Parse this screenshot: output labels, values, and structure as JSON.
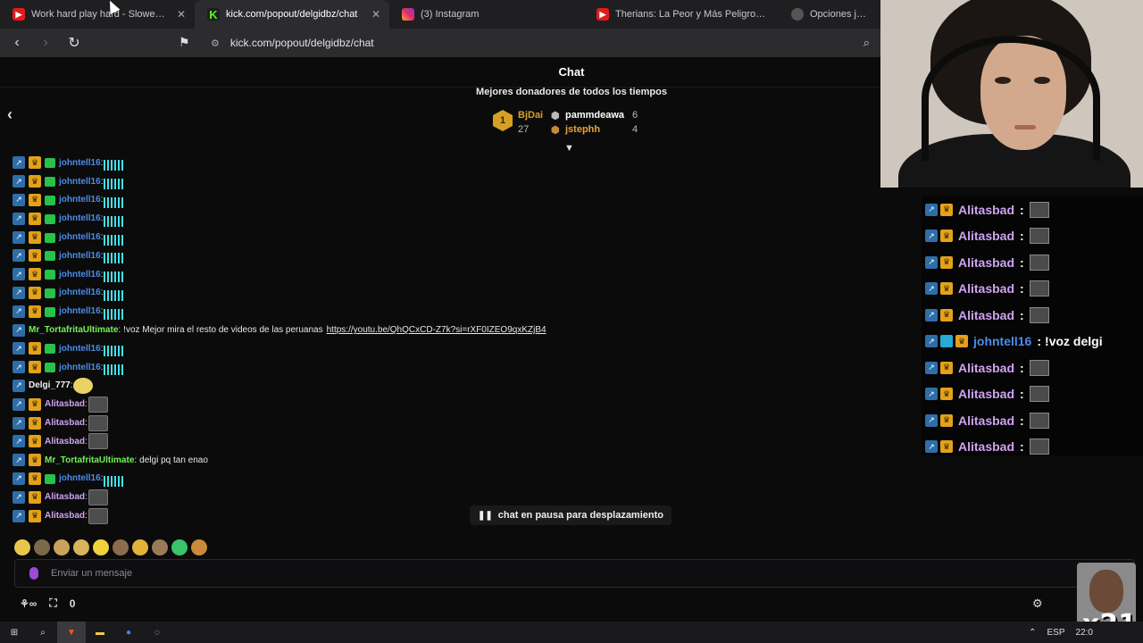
{
  "tabs": [
    {
      "title": "Work hard play hard - Slowed (T",
      "favicon": "youtube-icon"
    },
    {
      "title": "kick.com/popout/delgidbz/chat",
      "favicon": "kick-icon",
      "active": true
    },
    {
      "title": "(3) Instagram",
      "favicon": "instagram-icon"
    },
    {
      "title": "Therians: La Peor y Más Peligrosa Mo",
      "favicon": "youtube-icon"
    },
    {
      "title": "Opciones juegos",
      "favicon": "settings-icon"
    }
  ],
  "address": {
    "url": "kick.com/popout/delgidbz/chat"
  },
  "chat": {
    "title": "Chat",
    "donors_title": "Mejores donadores de todos los tiempos",
    "donors": [
      {
        "rank": "1",
        "name": "BjDai",
        "amount": "27"
      },
      {
        "name": "pammdeawa",
        "amount": "6"
      },
      {
        "name": "jstephh",
        "amount": "4"
      }
    ],
    "messages": [
      {
        "user": "johntell16",
        "color": "blue",
        "badges": [
          "verified",
          "crown",
          "gift"
        ],
        "emote": "bars"
      },
      {
        "user": "johntell16",
        "color": "blue",
        "badges": [
          "verified",
          "crown",
          "gift"
        ],
        "emote": "bars"
      },
      {
        "user": "johntell16",
        "color": "blue",
        "badges": [
          "verified",
          "crown",
          "gift"
        ],
        "emote": "bars"
      },
      {
        "user": "johntell16",
        "color": "blue",
        "badges": [
          "verified",
          "crown",
          "gift"
        ],
        "emote": "bars"
      },
      {
        "user": "johntell16",
        "color": "blue",
        "badges": [
          "verified",
          "crown",
          "gift"
        ],
        "emote": "bars"
      },
      {
        "user": "johntell16",
        "color": "blue",
        "badges": [
          "verified",
          "crown",
          "gift"
        ],
        "emote": "bars"
      },
      {
        "user": "johntell16",
        "color": "blue",
        "badges": [
          "verified",
          "crown",
          "gift"
        ],
        "emote": "bars"
      },
      {
        "user": "johntell16",
        "color": "blue",
        "badges": [
          "verified",
          "crown",
          "gift"
        ],
        "emote": "bars"
      },
      {
        "user": "johntell16",
        "color": "blue",
        "badges": [
          "verified",
          "crown",
          "gift"
        ],
        "emote": "bars"
      },
      {
        "user": "Mr_TortafritaUltimate",
        "color": "green",
        "badges": [
          "verified"
        ],
        "text": "!voz Mejor mira el resto de videos de las peruanas",
        "link": "https://youtu.be/QhQCxCD-Z7k?si=rXF0IZEO9qxKZjB4"
      },
      {
        "user": "johntell16",
        "color": "blue",
        "badges": [
          "verified",
          "crown",
          "gift"
        ],
        "emote": "bars"
      },
      {
        "user": "johntell16",
        "color": "blue",
        "badges": [
          "verified",
          "crown",
          "gift"
        ],
        "emote": "bars"
      },
      {
        "user": "Delgi_777",
        "color": "white",
        "badges": [
          "verified"
        ],
        "emote": "yellow"
      },
      {
        "user": "Alitasbad",
        "color": "pink",
        "badges": [
          "verified",
          "crown"
        ],
        "emote": "face"
      },
      {
        "user": "Alitasbad",
        "color": "pink",
        "badges": [
          "verified",
          "crown"
        ],
        "emote": "face"
      },
      {
        "user": "Alitasbad",
        "color": "pink",
        "badges": [
          "verified",
          "crown"
        ],
        "emote": "face"
      },
      {
        "user": "Mr_TortafritaUltimate",
        "color": "green",
        "badges": [
          "verified",
          "crown"
        ],
        "text": "delgi pq tan enao"
      },
      {
        "user": "johntell16",
        "color": "blue",
        "badges": [
          "verified",
          "crown",
          "gift"
        ],
        "emote": "bars"
      },
      {
        "user": "Alitasbad",
        "color": "pink",
        "badges": [
          "verified",
          "crown"
        ],
        "emote": "face"
      },
      {
        "user": "Alitasbad",
        "color": "pink",
        "badges": [
          "verified",
          "crown"
        ],
        "emote": "face"
      }
    ],
    "paused_text": "chat en pausa para desplazamiento",
    "input_placeholder": "Enviar un mensaje",
    "points": "0"
  },
  "overlay": {
    "messages": [
      {
        "user": "Alitasbad",
        "color": "pink",
        "emote": "face"
      },
      {
        "user": "Alitasbad",
        "color": "pink",
        "emote": "face"
      },
      {
        "user": "Alitasbad",
        "color": "pink",
        "emote": "face"
      },
      {
        "user": "Alitasbad",
        "color": "pink",
        "emote": "face"
      },
      {
        "user": "Alitasbad",
        "color": "pink",
        "emote": "face"
      },
      {
        "user": "johntell16",
        "color": "blue",
        "text": "!voz delgi",
        "cube": true
      },
      {
        "user": "Alitasbad",
        "color": "pink",
        "emote": "face"
      },
      {
        "user": "Alitasbad",
        "color": "pink",
        "emote": "face"
      },
      {
        "user": "Alitasbad",
        "color": "pink",
        "emote": "face"
      },
      {
        "user": "Alitasbad",
        "color": "pink",
        "emote": "face"
      }
    ]
  },
  "taskbar": {
    "lang": "ESP",
    "time": "22:0"
  },
  "cam2_label": "x21",
  "colors": {
    "blue": "#4a8ce8",
    "green": "#74f05a",
    "pink": "#d0a3f2",
    "white": "#f2f2f2",
    "kick": "#53fc18"
  }
}
